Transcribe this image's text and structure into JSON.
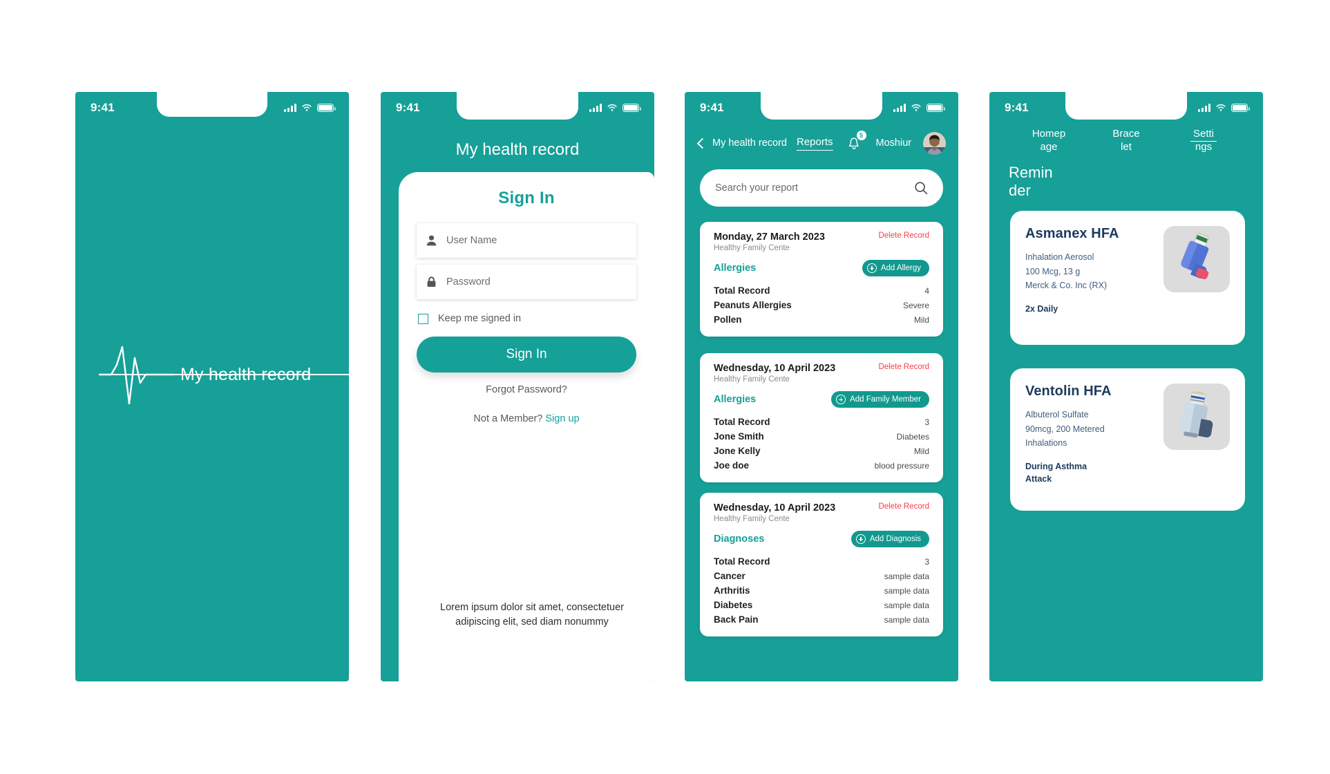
{
  "statusbar": {
    "time": "9:41"
  },
  "screen1": {
    "logo_icon": "heartbeat-ecg-icon",
    "title": "My health record"
  },
  "screen2": {
    "header_title": "My health record",
    "sheet_title": "Sign In",
    "username": {
      "placeholder": "User Name",
      "value": "",
      "icon": "user-icon"
    },
    "password": {
      "placeholder": "Password",
      "value": "",
      "icon": "lock-icon"
    },
    "keep_signed_in": {
      "label": "Keep me signed in",
      "checked": false
    },
    "signin_button": "Sign In",
    "forgot_password": "Forgot Password?",
    "member_prompt": "Not a Member?",
    "signup_link": "Sign up",
    "footer_text": "Lorem ipsum dolor sit amet, consectetuer adipiscing elit, sed diam nonummy"
  },
  "screen3": {
    "nav": {
      "back_icon": "back-chevron-icon",
      "brand": "My health record",
      "active_tab": "Reports",
      "bell_icon": "bell-icon",
      "notification_count": "5",
      "user_name": "Moshiur",
      "avatar": "user-avatar"
    },
    "search": {
      "placeholder": "Search your report",
      "value": "",
      "icon": "search-icon"
    },
    "cards": [
      {
        "date": "Monday, 27 March 2023",
        "clinic": "Healthy Family Cente",
        "delete_label": "Delete Record",
        "category": "Allergies",
        "action_label": "Add Allergy",
        "rows": [
          {
            "key": "Total Record",
            "value": "4"
          },
          {
            "key": "Peanuts Allergies",
            "value": "Severe"
          },
          {
            "key": "Pollen",
            "value": "Mild"
          }
        ]
      },
      {
        "date": "Wednesday, 10 April 2023",
        "clinic": "Healthy Family Cente",
        "delete_label": "Delete Record",
        "category": "Allergies",
        "action_label": "Add Family Member",
        "rows": [
          {
            "key": "Total Record",
            "value": "3"
          },
          {
            "key": "Jone Smith",
            "value": "Diabetes"
          },
          {
            "key": "Jone Kelly",
            "value": "Mild"
          },
          {
            "key": "Joe doe",
            "value": "blood pressure"
          }
        ]
      },
      {
        "date": "Wednesday, 10 April 2023",
        "clinic": "Healthy Family Cente",
        "delete_label": "Delete Record",
        "category": "Diagnoses",
        "action_label": "Add Diagnosis",
        "rows": [
          {
            "key": "Total Record",
            "value": "3"
          },
          {
            "key": "Cancer",
            "value": "sample data"
          },
          {
            "key": "Arthritis",
            "value": "sample data"
          },
          {
            "key": "Diabetes",
            "value": "sample data"
          },
          {
            "key": "Back Pain",
            "value": "sample data"
          }
        ]
      }
    ]
  },
  "screen4": {
    "nav": [
      {
        "l1": "Homep",
        "l2": "age",
        "active": false
      },
      {
        "l1": "Brace",
        "l2": "let",
        "active": false
      },
      {
        "l1": "Setti",
        "l2": "ngs",
        "active": true
      }
    ],
    "section_title_l1": "Remin",
    "section_title_l2": "der",
    "medications": [
      {
        "name": "Asmanex HFA",
        "desc": "Inhalation Aerosol\n100 Mcg, 13 g\nMerck & Co. Inc (RX)",
        "frequency": "2x Daily",
        "image": "blue-inhaler-photo"
      },
      {
        "name": "Ventolin HFA",
        "desc": "Albuterol Sulfate\n90mcg, 200 Metered\nInhalations",
        "frequency": "During Asthma\nAttack",
        "image": "light-blue-inhaler-photo"
      }
    ]
  },
  "colors": {
    "brand_teal": "#16a098",
    "accent_teal": "#15a098",
    "danger_red": "#fb3b46",
    "med_navy": "#1b3a5e"
  }
}
